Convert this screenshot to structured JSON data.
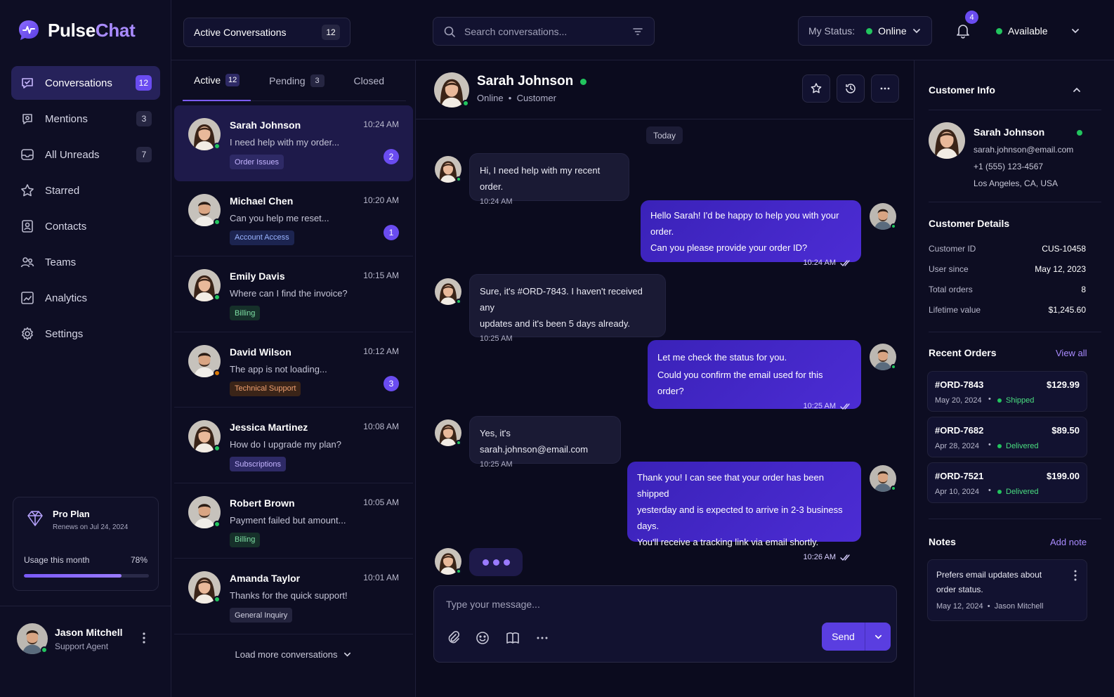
{
  "app": {
    "name_main": "Pulse",
    "name_accent": "Chat"
  },
  "colors": {
    "accent": "#7c5cff",
    "online": "#22c55e",
    "bg": "#0b0b1e"
  },
  "nav": {
    "items": [
      {
        "label": "Conversations",
        "count": "12",
        "icon": "chat-bubble-icon",
        "active": true
      },
      {
        "label": "Mentions",
        "count": "3",
        "icon": "at-icon"
      },
      {
        "label": "All Unreads",
        "count": "7",
        "icon": "inbox-icon"
      },
      {
        "label": "Starred",
        "count": "",
        "icon": "star-icon"
      },
      {
        "label": "Contacts",
        "count": "",
        "icon": "contacts-icon"
      },
      {
        "label": "Teams",
        "count": "",
        "icon": "team-icon"
      },
      {
        "label": "Analytics",
        "count": "",
        "icon": "analytics-icon"
      },
      {
        "label": "Settings",
        "count": "",
        "icon": "gear-icon"
      }
    ]
  },
  "plan": {
    "title": "Pro Plan",
    "renews": "Renews on Jul 24, 2024",
    "usage_label": "Usage this month",
    "usage_value": "78%",
    "usage_fraction": 0.78
  },
  "agent": {
    "name": "Jason Mitchell",
    "role": "Support Agent"
  },
  "topbar": {
    "active_label": "Active Conversations",
    "active_count": "12",
    "search_placeholder": "Search conversations...",
    "status_label": "My Status:",
    "status_value": "Online",
    "notifications": "4",
    "availability": "Available"
  },
  "list": {
    "tabs": [
      {
        "label": "Active",
        "count": "12"
      },
      {
        "label": "Pending",
        "count": "3"
      },
      {
        "label": "Closed",
        "count": ""
      }
    ],
    "conversations": [
      {
        "name": "Sarah Johnson",
        "time": "10:24 AM",
        "preview": "I need help with my order...",
        "tag": "Order Issues",
        "unread": "2"
      },
      {
        "name": "Michael Chen",
        "time": "10:20 AM",
        "preview": "Can you help me reset...",
        "tag": "Account Access",
        "unread": "1"
      },
      {
        "name": "Emily Davis",
        "time": "10:15 AM",
        "preview": "Where can I find the invoice?",
        "tag": "Billing",
        "unread": ""
      },
      {
        "name": "David Wilson",
        "time": "10:12 AM",
        "preview": "The app is not loading...",
        "tag": "Technical Support",
        "unread": "3"
      },
      {
        "name": "Jessica Martinez",
        "time": "10:08 AM",
        "preview": "How do I upgrade my plan?",
        "tag": "Subscriptions",
        "unread": ""
      },
      {
        "name": "Robert Brown",
        "time": "10:05 AM",
        "preview": "Payment failed but amount...",
        "tag": "Billing",
        "unread": ""
      },
      {
        "name": "Amanda Taylor",
        "time": "10:01 AM",
        "preview": "Thanks for the quick support!",
        "tag": "General Inquiry",
        "unread": ""
      }
    ],
    "load_more": "Load more conversations"
  },
  "chat": {
    "name": "Sarah Johnson",
    "status": "Online",
    "role": "Customer",
    "day": "Today",
    "messages": [
      {
        "from": "customer",
        "lines": [
          "Hi, I need help with my recent order."
        ],
        "time": "10:24 AM"
      },
      {
        "from": "agent",
        "lines": [
          "Hello Sarah! I'd be happy to help you with your order.",
          "Can you please provide your order ID?"
        ],
        "time": "10:24 AM"
      },
      {
        "from": "customer",
        "lines": [
          "Sure, it's #ORD-7843. I haven't received any",
          "updates and it's been 5 days already."
        ],
        "time": "10:25 AM"
      },
      {
        "from": "agent",
        "lines": [
          "Let me check the status for you.",
          "Could you confirm the email used for this order?"
        ],
        "time": "10:25 AM"
      },
      {
        "from": "customer",
        "lines": [
          "Yes, it's sarah.johnson@email.com"
        ],
        "time": "10:25 AM"
      },
      {
        "from": "agent",
        "lines": [
          "Thank you! I can see that your order has been shipped",
          "yesterday and is expected to arrive in 2-3 business days.",
          "You'll receive a tracking link via email shortly."
        ],
        "time": "10:26 AM"
      }
    ],
    "composer_placeholder": "Type your message...",
    "send_label": "Send"
  },
  "customer": {
    "section_title": "Customer Info",
    "name": "Sarah Johnson",
    "email": "sarah.johnson@email.com",
    "phone": "+1 (555) 123-4567",
    "location": "Los Angeles, CA, USA",
    "details_title": "Customer Details",
    "details": [
      {
        "key": "Customer ID",
        "value": "CUS-10458"
      },
      {
        "key": "User since",
        "value": "May 12, 2023"
      },
      {
        "key": "Total orders",
        "value": "8"
      },
      {
        "key": "Lifetime value",
        "value": "$1,245.60"
      }
    ],
    "orders_title": "Recent Orders",
    "orders_link": "View all",
    "orders": [
      {
        "id": "#ORD-7843",
        "amount": "$129.99",
        "date": "May 20, 2024",
        "status": "Shipped"
      },
      {
        "id": "#ORD-7682",
        "amount": "$89.50",
        "date": "Apr 28, 2024",
        "status": "Delivered"
      },
      {
        "id": "#ORD-7521",
        "amount": "$199.00",
        "date": "Apr 10, 2024",
        "status": "Delivered"
      }
    ],
    "notes_title": "Notes",
    "notes_link": "Add note",
    "note": {
      "text": "Prefers email updates about order status.",
      "date": "May 12, 2024",
      "author": "Jason Mitchell"
    }
  }
}
